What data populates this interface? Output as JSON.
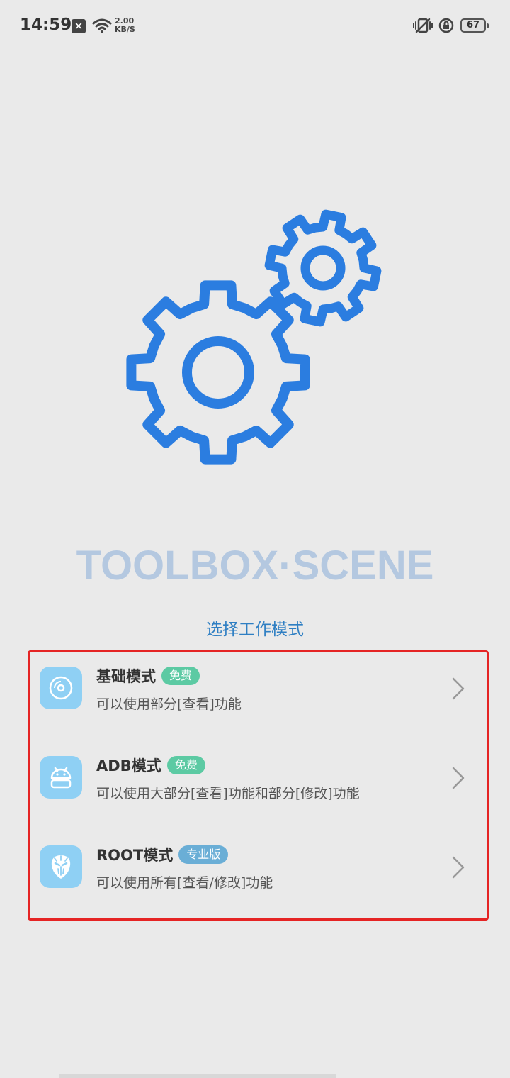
{
  "status_bar": {
    "time": "14:59",
    "notification_icon": "x-icon",
    "net_speed_value": "2.00",
    "net_speed_unit": "KB/S",
    "battery": "67"
  },
  "brand": {
    "name": "TOOLBOX·SCENE"
  },
  "prompt": "选择工作模式",
  "modes": [
    {
      "title": "基础模式",
      "badge": "免费",
      "badge_color": "#5ccaa3",
      "description": "可以使用部分[查看]功能",
      "icon": "disc-icon"
    },
    {
      "title": "ADB模式",
      "badge": "免费",
      "badge_color": "#5ccaa3",
      "description": "可以使用大部分[查看]功能和部分[修改]功能",
      "icon": "android-icon"
    },
    {
      "title": "ROOT模式",
      "badge": "专业版",
      "badge_color": "#6aaed6",
      "description": "可以使用所有[查看/修改]功能",
      "icon": "mask-icon"
    }
  ],
  "colors": {
    "accent": "#2b7de0",
    "highlight_border": "#e52424",
    "icon_bg": "#8fd0f4"
  }
}
